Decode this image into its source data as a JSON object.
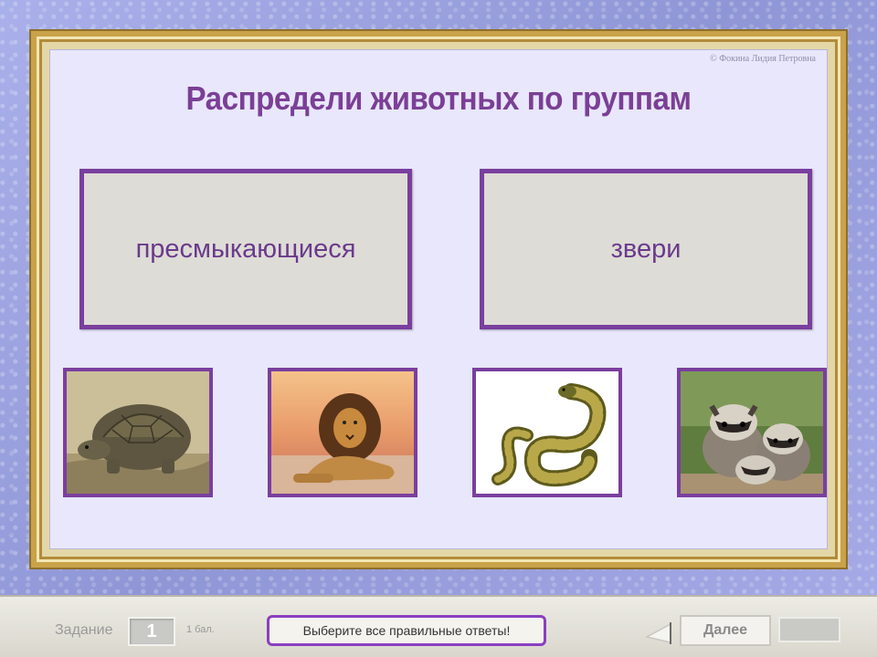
{
  "slide": {
    "copyright": "© Фокина Лидия Петровна",
    "title": "Распредели животных по группам",
    "groups": [
      {
        "label": "пресмыкающиеся"
      },
      {
        "label": "звери"
      }
    ],
    "animals": [
      {
        "name": "tortoise"
      },
      {
        "name": "lion"
      },
      {
        "name": "snake"
      },
      {
        "name": "raccoons"
      }
    ]
  },
  "toolbar": {
    "task_label": "Задание",
    "task_number": "1",
    "score": "1 бал.",
    "hint": "Выберите все правильные ответы!",
    "next_label": "Далее"
  },
  "colors": {
    "accent": "#7a3f9e",
    "title": "#7b3f96",
    "board": "#e8e7fb"
  }
}
